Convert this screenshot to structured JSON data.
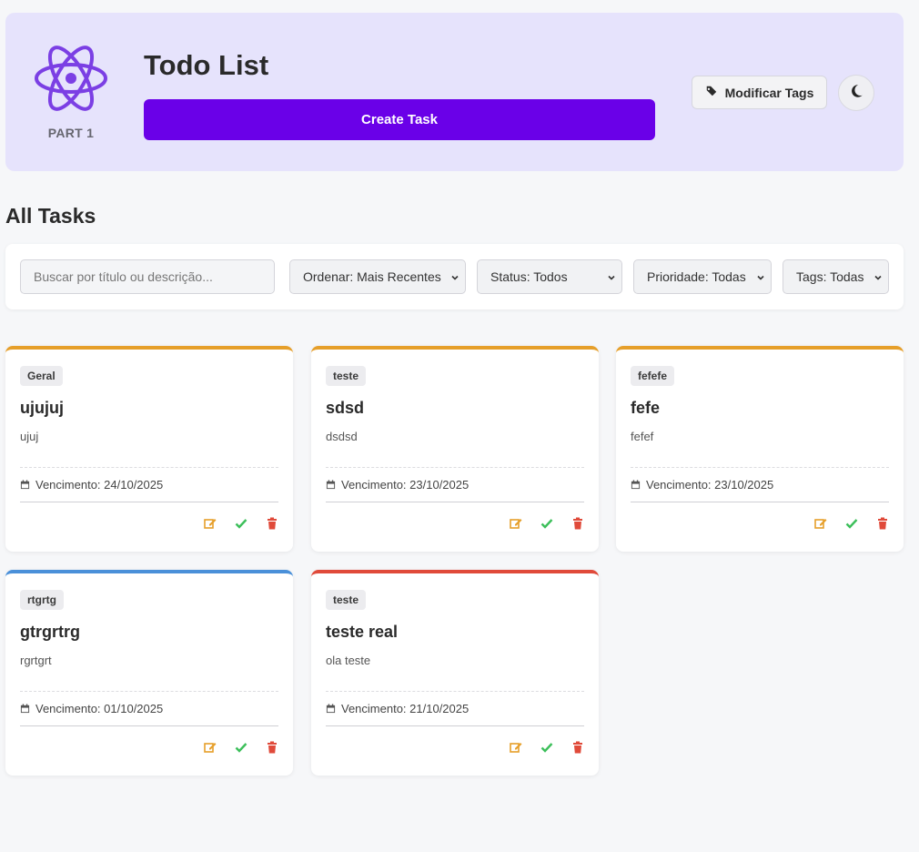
{
  "header": {
    "part_label": "PART 1",
    "title": "Todo List",
    "create_label": "Create Task",
    "tags_label": "Modificar Tags",
    "theme_icon": "moon-icon",
    "accent_color": "#6a00e8"
  },
  "section_title": "All Tasks",
  "filters": {
    "search_placeholder": "Buscar por título ou descrição...",
    "sort": "Ordenar: Mais Recentes",
    "status": "Status: Todos",
    "priority": "Prioridade: Todas",
    "tags": "Tags: Todas"
  },
  "tasks": [
    {
      "tag": "Geral",
      "title": "ujujuj",
      "description": "ujuj",
      "due": "Vencimento: 24/10/2025",
      "color": "#e69f2a"
    },
    {
      "tag": "teste",
      "title": "sdsd",
      "description": "dsdsd",
      "due": "Vencimento: 23/10/2025",
      "color": "#e69f2a"
    },
    {
      "tag": "fefefe",
      "title": "fefe",
      "description": "fefef",
      "due": "Vencimento: 23/10/2025",
      "color": "#e69f2a"
    },
    {
      "tag": "rtgrtg",
      "title": "gtrgrtrg",
      "description": "rgrtgrt",
      "due": "Vencimento: 01/10/2025",
      "color": "#4a90d9"
    },
    {
      "tag": "teste",
      "title": "teste real",
      "description": "ola teste",
      "due": "Vencimento: 21/10/2025",
      "color": "#e04a3a"
    }
  ]
}
